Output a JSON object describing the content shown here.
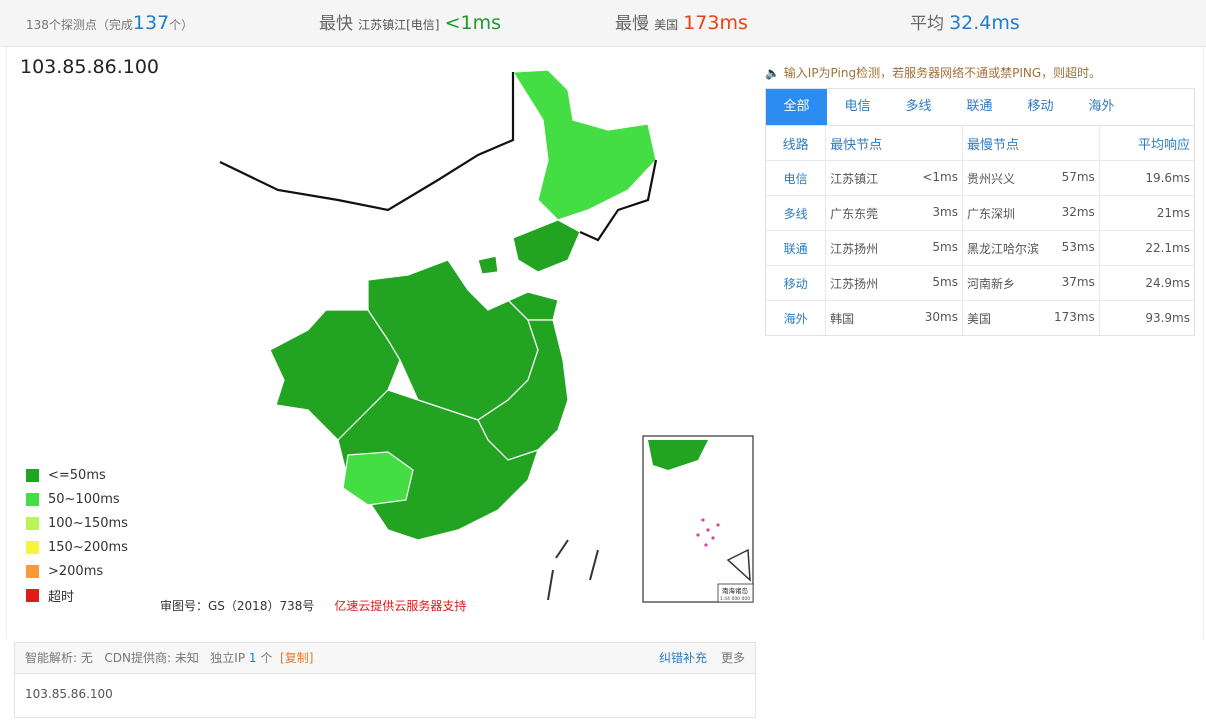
{
  "header": {
    "probes_prefix": "138个探测点（完成",
    "probes_done": "137",
    "probes_suffix": "个）",
    "fastest_label": "最快",
    "fastest_node": "江苏镇江[电信]",
    "fastest_value": "<1ms",
    "slowest_label": "最慢",
    "slowest_node": "美国",
    "slowest_value": "173ms",
    "avg_label": "平均",
    "avg_value": "32.4ms"
  },
  "target_ip": "103.85.86.100",
  "notice": "输入IP为Ping检测，若服务器网络不通或禁PING，则超时。",
  "tabs": [
    "全部",
    "电信",
    "多线",
    "联通",
    "移动",
    "海外"
  ],
  "active_tab": 0,
  "table": {
    "headers": [
      "线路",
      "最快节点",
      "最慢节点",
      "平均响应"
    ],
    "rows": [
      {
        "line": "电信",
        "fast_node": "江苏镇江",
        "fast_ms": "<1ms",
        "slow_node": "贵州兴义",
        "slow_ms": "57ms",
        "avg": "19.6ms"
      },
      {
        "line": "多线",
        "fast_node": "广东东莞",
        "fast_ms": "3ms",
        "slow_node": "广东深圳",
        "slow_ms": "32ms",
        "avg": "21ms"
      },
      {
        "line": "联通",
        "fast_node": "江苏扬州",
        "fast_ms": "5ms",
        "slow_node": "黑龙江哈尔滨",
        "slow_ms": "53ms",
        "avg": "22.1ms"
      },
      {
        "line": "移动",
        "fast_node": "江苏扬州",
        "fast_ms": "5ms",
        "slow_node": "河南新乡",
        "slow_ms": "37ms",
        "avg": "24.9ms"
      },
      {
        "line": "海外",
        "fast_node": "韩国",
        "fast_ms": "30ms",
        "slow_node": "美国",
        "slow_ms": "173ms",
        "avg": "93.9ms"
      }
    ]
  },
  "legend": [
    {
      "label": "<=50ms",
      "color": "#22a322"
    },
    {
      "label": "50~100ms",
      "color": "#44dd44"
    },
    {
      "label": "100~150ms",
      "color": "#b9f55a"
    },
    {
      "label": "150~200ms",
      "color": "#f5f53a"
    },
    {
      "label": ">200ms",
      "color": "#f59b3a"
    },
    {
      "label": "超时",
      "color": "#e41a1a"
    }
  ],
  "map": {
    "caption": "审图号：GS（2018）738号",
    "sponsor": "亿速云提供云服务器支持",
    "inset_label": "南海诸岛",
    "inset_scale": "1:44 000 000"
  },
  "footer": {
    "dns_label": "智能解析:",
    "dns_value": "无",
    "cdn_label": "CDN提供商:",
    "cdn_value": "未知",
    "ip_label": "独立IP",
    "ip_count": "1",
    "ip_unit": "个",
    "copy": "[复制]",
    "correct": "纠错补充",
    "more": "更多",
    "ip_list": "103.85.86.100"
  }
}
